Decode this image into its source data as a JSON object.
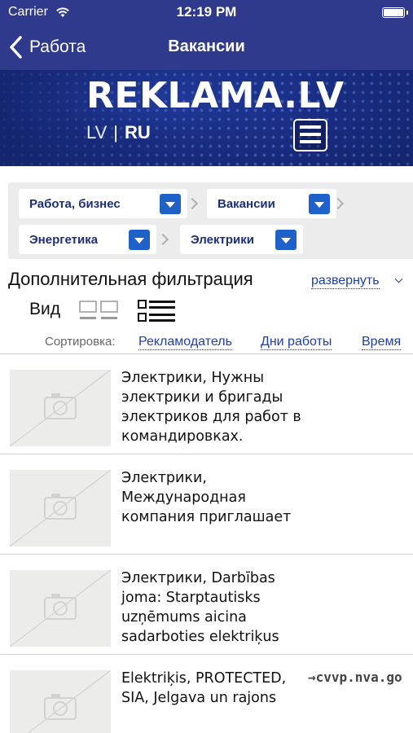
{
  "status": {
    "carrier": "Carrier",
    "time": "12:19 PM"
  },
  "nav": {
    "back_label": "Работа",
    "title": "Вакансии"
  },
  "banner": {
    "logo": "REKLAMA.LV",
    "lang_lv": "LV",
    "separator": "|",
    "lang_ru": "RU"
  },
  "breadcrumbs": [
    {
      "label": "Работа, бизнес"
    },
    {
      "label": "Вакансии"
    },
    {
      "label": "Энергетика"
    },
    {
      "label": "Электрики"
    }
  ],
  "filter": {
    "heading": "Дополнительная фильтрация",
    "expand_label": "развернуть"
  },
  "view": {
    "label": "Вид"
  },
  "sort": {
    "label": "Сортировка:",
    "options": [
      "Рекламодатель",
      "Дни работы",
      "Время"
    ]
  },
  "listings": [
    {
      "text": "Электрики, Нужны электрики и бригады электриков для работ в командировках.",
      "source": ""
    },
    {
      "text": "Электрики, Международная компания приглашает",
      "source": ""
    },
    {
      "text": "Электрики, Darbības joma: Starptautisks uzņēmums aicina sadarboties elektriķus",
      "source": ""
    },
    {
      "text": "Elektriķis, PROTECTED, SIA, Jelgava un rajons",
      "source": "→cvvp.nva.go"
    }
  ],
  "colors": {
    "nav_bar": "#2f3a8c",
    "link": "#1d3fa6",
    "dropdown": "#1e61c8",
    "crumb_text": "#1d2e7a"
  },
  "icons": [
    "wifi-icon",
    "battery-icon",
    "back-chevron-icon",
    "hamburger-menu-icon",
    "dropdown-arrow-icon",
    "grid-view-icon",
    "list-view-icon",
    "camera-placeholder-icon"
  ]
}
